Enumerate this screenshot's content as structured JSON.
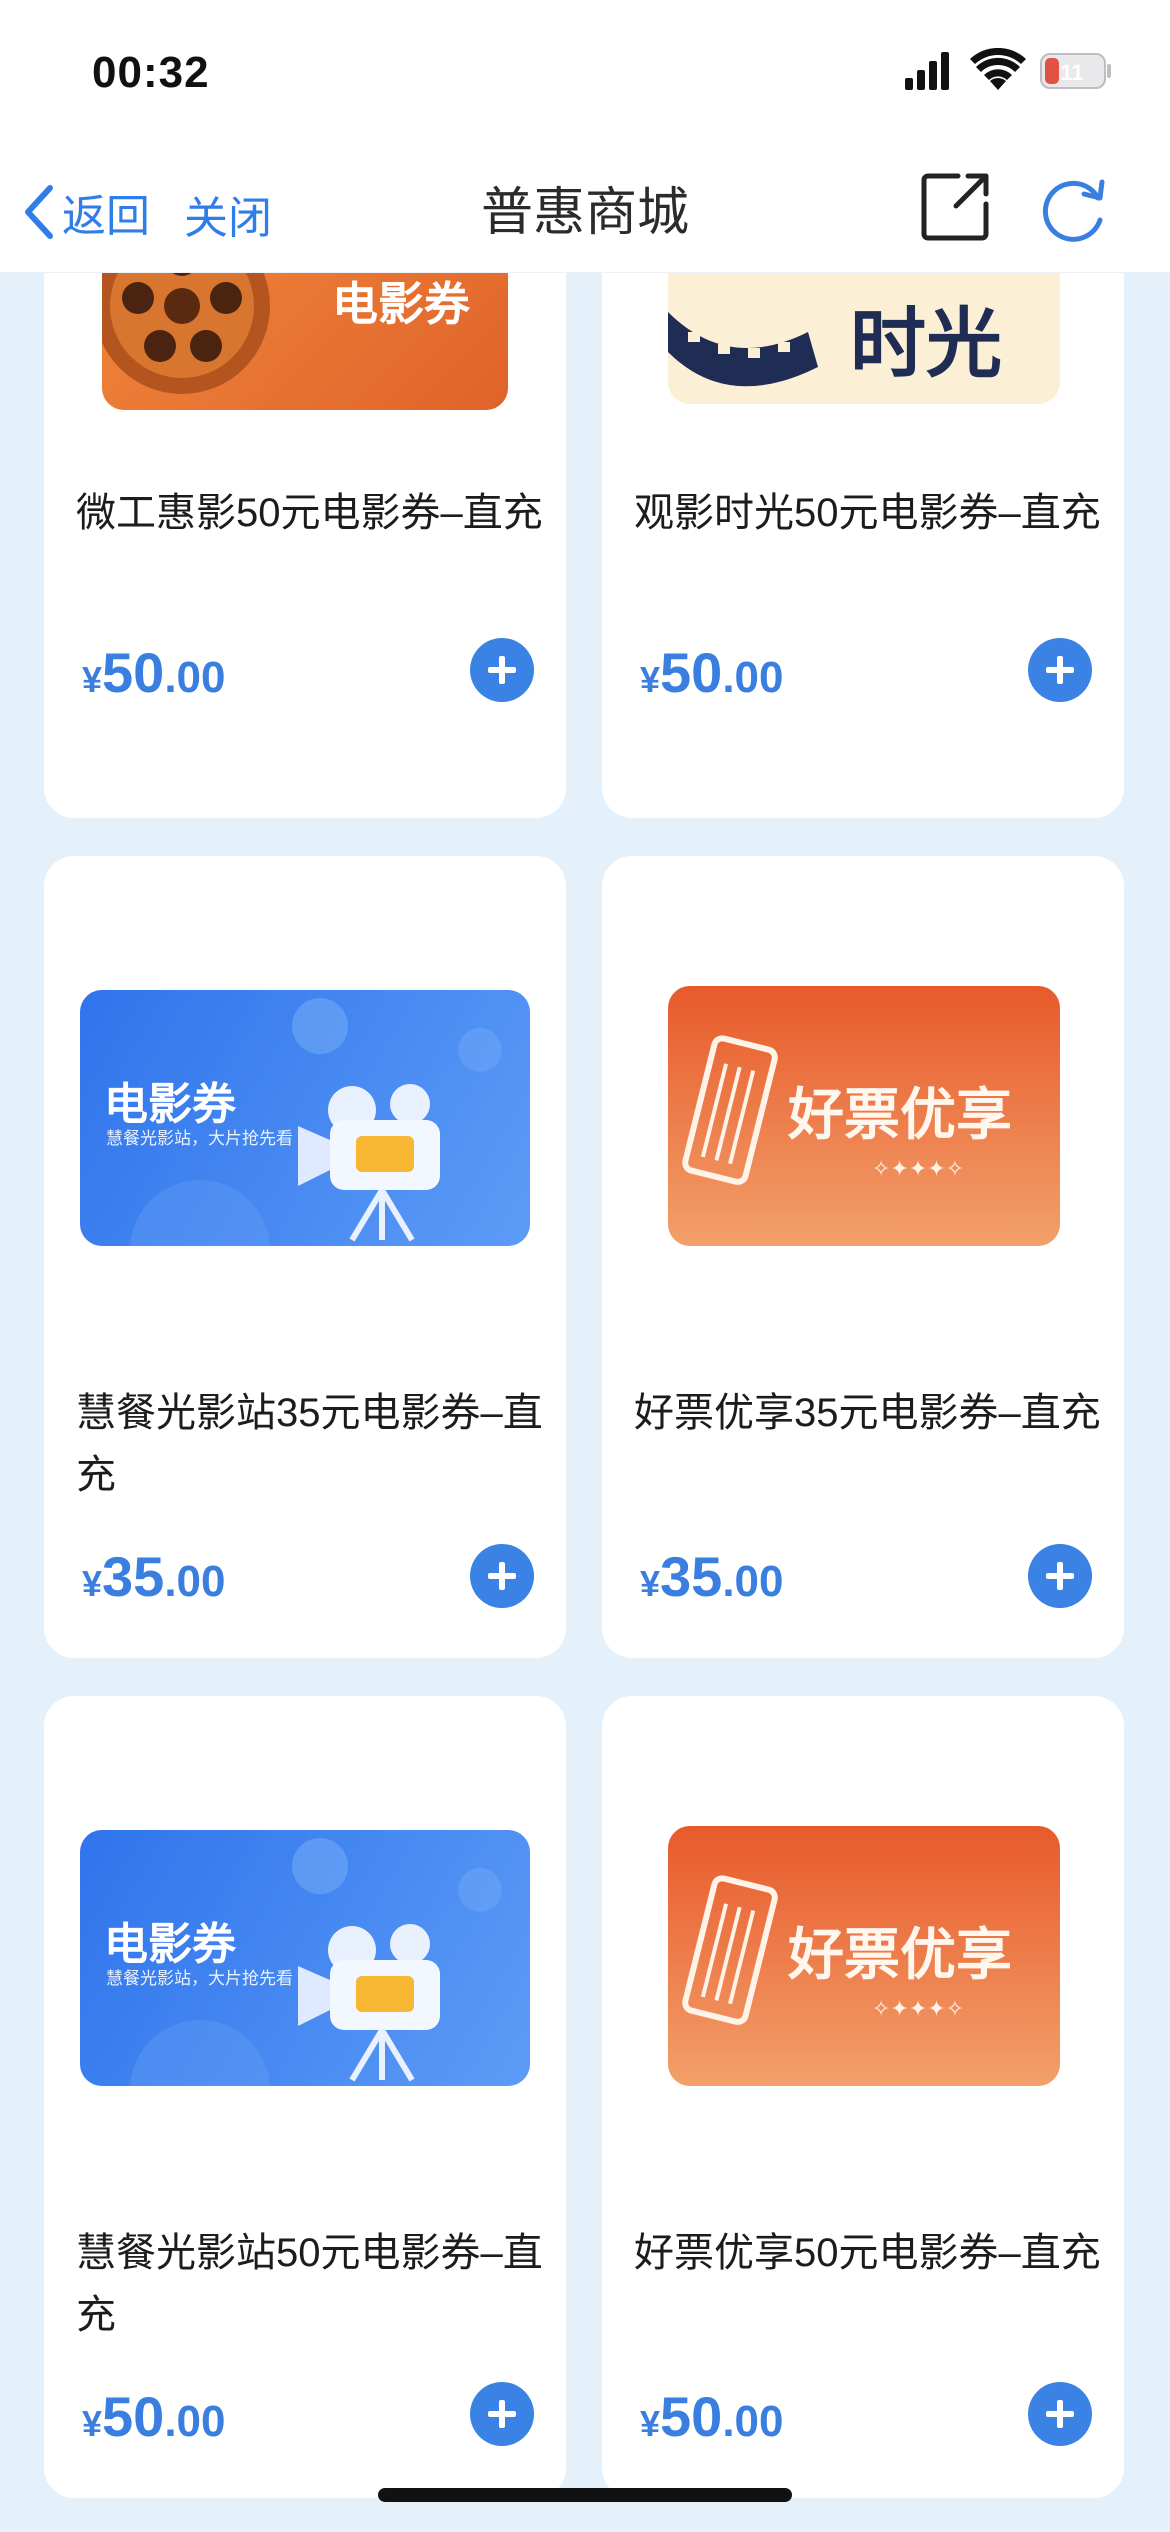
{
  "status": {
    "time": "00:32",
    "battery": "11"
  },
  "nav": {
    "back_label": "返回",
    "close_label": "关闭",
    "title": "普惠商城"
  },
  "products": [
    {
      "name": "微工惠影50元电影券–直充",
      "price_yen": "¥",
      "price_int": "50",
      "price_dec": ".00",
      "image_text": "电影券"
    },
    {
      "name": "观影时光50元电影券–直充",
      "price_yen": "¥",
      "price_int": "50",
      "price_dec": ".00",
      "image_text": "时光"
    },
    {
      "name": "慧餐光影站35元电影券–直充",
      "price_yen": "¥",
      "price_int": "35",
      "price_dec": ".00",
      "image_title": "电影券",
      "image_sub": "慧餐光影站，大片抢先看"
    },
    {
      "name": "好票优享35元电影券–直充",
      "price_yen": "¥",
      "price_int": "35",
      "price_dec": ".00",
      "image_title": "好票优享"
    },
    {
      "name": "慧餐光影站50元电影券–直充",
      "price_yen": "¥",
      "price_int": "50",
      "price_dec": ".00",
      "image_title": "电影券",
      "image_sub": "慧餐光影站，大片抢先看"
    },
    {
      "name": "好票优享50元电影券–直充",
      "price_yen": "¥",
      "price_int": "50",
      "price_dec": ".00",
      "image_title": "好票优享"
    }
  ],
  "colors": {
    "accent": "#3a82e4",
    "page_bg": "#e4f1fb"
  }
}
